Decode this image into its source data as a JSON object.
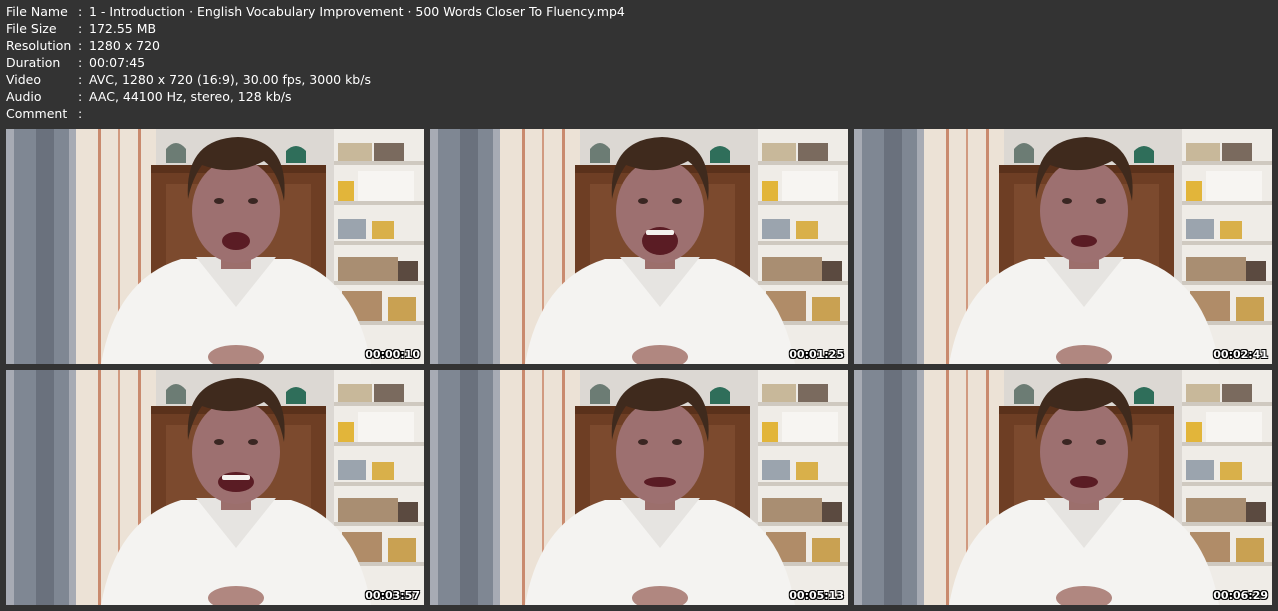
{
  "info": [
    {
      "key": "File Name",
      "value": "1 - Introduction · English Vocabulary Improvement · 500 Words Closer To Fluency.mp4"
    },
    {
      "key": "File Size",
      "value": "172.55 MB"
    },
    {
      "key": "Resolution",
      "value": "1280 x 720"
    },
    {
      "key": "Duration",
      "value": "00:07:45"
    },
    {
      "key": "Video",
      "value": "AVC, 1280 x 720 (16:9), 30.00 fps, 3000 kb/s"
    },
    {
      "key": "Audio",
      "value": "AAC, 44100 Hz, stereo, 128 kb/s"
    },
    {
      "key": "Comment",
      "value": ""
    }
  ],
  "separator": ":",
  "thumbnails": [
    {
      "timestamp": "00:00:10"
    },
    {
      "timestamp": "00:01:25"
    },
    {
      "timestamp": "00:02:41"
    },
    {
      "timestamp": "00:03:57"
    },
    {
      "timestamp": "00:05:13"
    },
    {
      "timestamp": "00:06:29"
    }
  ]
}
